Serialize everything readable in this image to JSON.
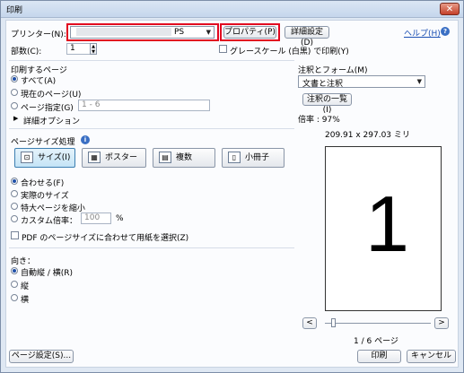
{
  "window": {
    "title": "印刷",
    "close_glyph": "✕"
  },
  "printer": {
    "label": "プリンター(N):",
    "value": "PS",
    "properties_btn": "プロパティ(P)",
    "advanced_btn": "詳細設定(D)",
    "help_link": "ヘルプ(H)",
    "copies_label": "部数(C):",
    "copies_value": "1",
    "grayscale_label": "グレースケール (白黒) で印刷(Y)"
  },
  "pages": {
    "heading": "印刷するページ",
    "all": "すべて(A)",
    "current": "現在のページ(U)",
    "range": "ページ指定(G)",
    "range_value": "1 - 6",
    "more": "詳細オプション"
  },
  "sizing": {
    "heading": "ページサイズ処理",
    "size_btn": "サイズ(I)",
    "poster_btn": "ポスター",
    "multiple_btn": "複数",
    "booklet_btn": "小冊子",
    "fit": "合わせる(F)",
    "actual": "実際のサイズ",
    "shrink": "特大ページを縮小",
    "custom": "カスタム倍率：",
    "custom_value": "100",
    "percent": "%",
    "pdf_paper": "PDF のページサイズに合わせて用紙を選択(Z)"
  },
  "orientation": {
    "heading": "向き：",
    "auto": "自動縦 / 横(R)",
    "portrait": "縦",
    "landscape": "横"
  },
  "comments": {
    "heading": "注釈とフォーム(M)",
    "value": "文書と注釈",
    "summary_btn": "注釈の一覧(I)",
    "scale": "倍率 : 97%",
    "dimensions": "209.91 x 297.03 ミリ",
    "preview_number": "1",
    "page_counter": "1 / 6 ページ",
    "prev": "<",
    "next": ">"
  },
  "footer": {
    "page_setup": "ページ設定(S)...",
    "print": "印刷",
    "cancel": "キャンセル"
  }
}
